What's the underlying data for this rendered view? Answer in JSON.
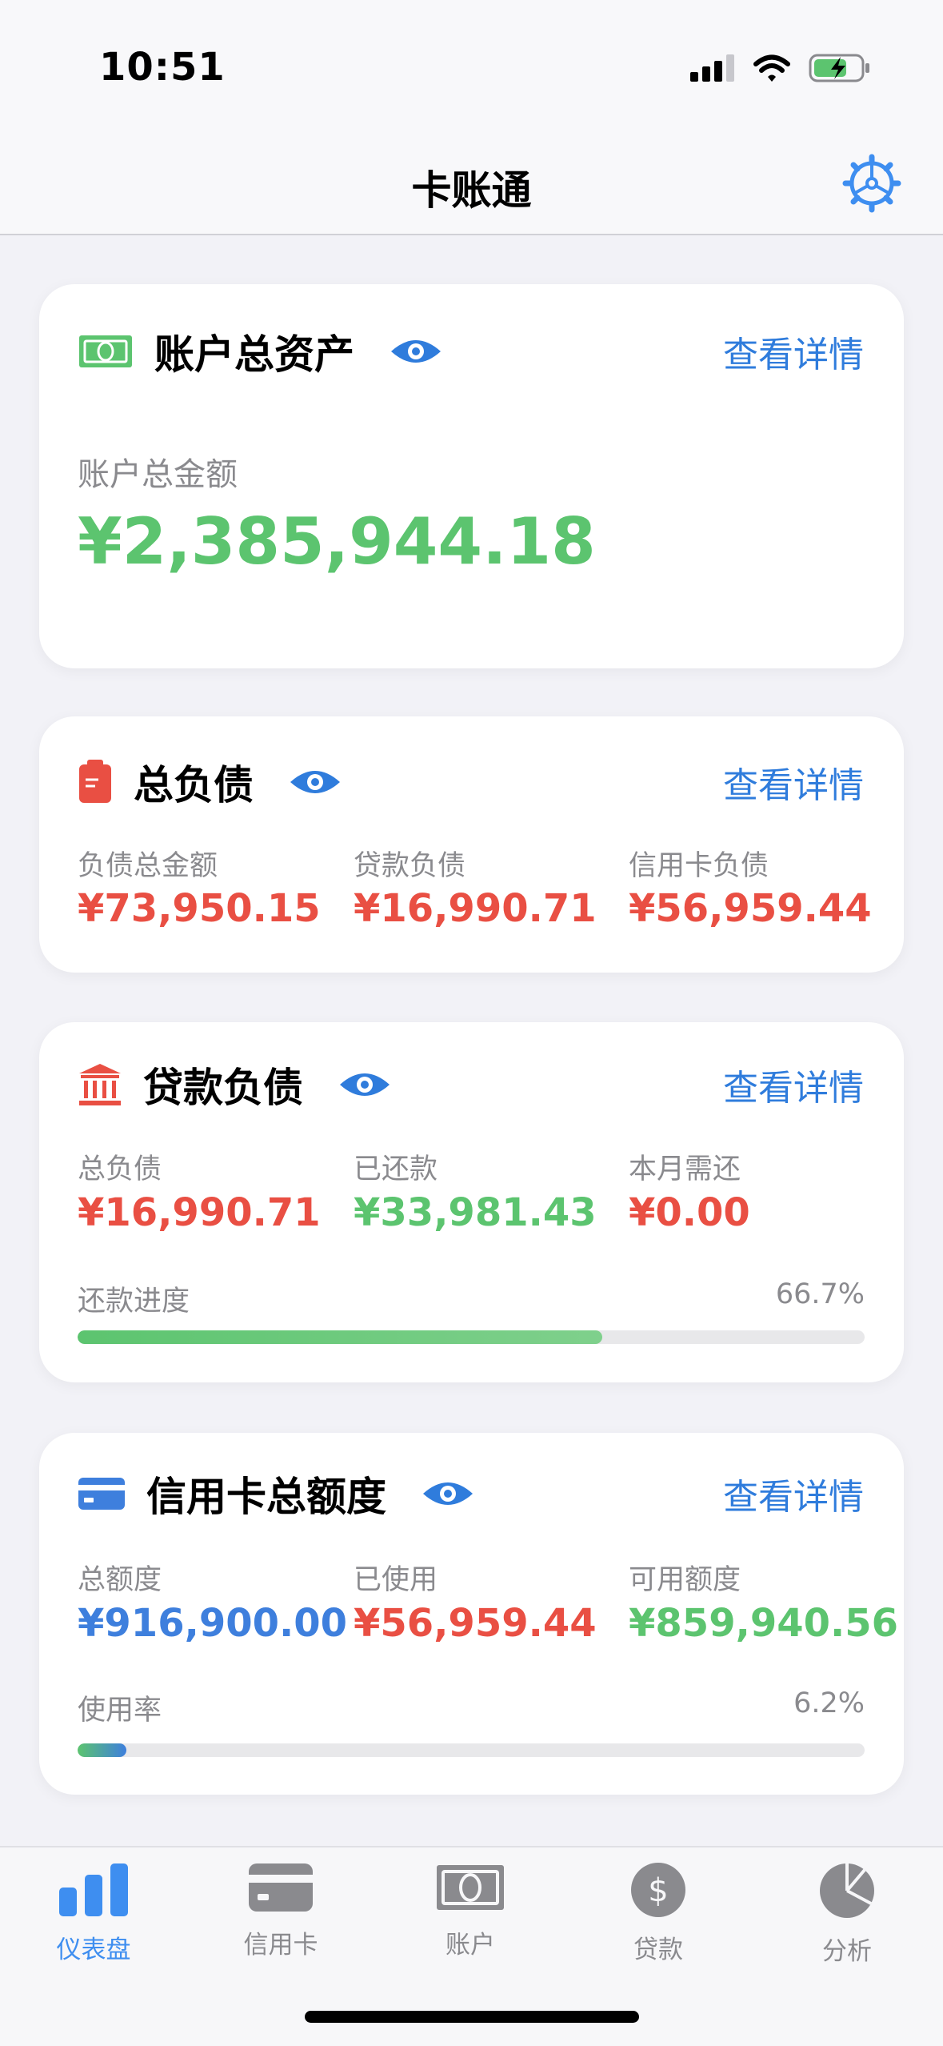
{
  "status": {
    "time": "10:51"
  },
  "nav": {
    "title": "卡账通"
  },
  "colors": {
    "accent": "#2f7cdc",
    "positive": "#5cc46f",
    "negative": "#e94f43",
    "primary_blue": "#3e7fdd"
  },
  "assets": {
    "title": "账户总资产",
    "detail_label": "查看详情",
    "total_label": "账户总金额",
    "total_value": "¥2,385,944.18",
    "icon": "cash-icon"
  },
  "liabilities": {
    "title": "总负债",
    "detail_label": "查看详情",
    "icon": "clipboard-icon",
    "items": [
      {
        "label": "负债总金额",
        "value": "¥73,950.15"
      },
      {
        "label": "贷款负债",
        "value": "¥16,990.71"
      },
      {
        "label": "信用卡负债",
        "value": "¥56,959.44"
      }
    ]
  },
  "loans": {
    "title": "贷款负债",
    "detail_label": "查看详情",
    "icon": "bank-icon",
    "items": [
      {
        "label": "总负债",
        "value": "¥16,990.71"
      },
      {
        "label": "已还款",
        "value": "¥33,981.43"
      },
      {
        "label": "本月需还",
        "value": "¥0.00"
      }
    ],
    "progress_label": "还款进度",
    "progress_pct": "66.7%",
    "progress_value": 66.7
  },
  "credit": {
    "title": "信用卡总额度",
    "detail_label": "查看详情",
    "icon": "credit-card-icon",
    "items": [
      {
        "label": "总额度",
        "value": "¥916,900.00"
      },
      {
        "label": "已使用",
        "value": "¥56,959.44"
      },
      {
        "label": "可用额度",
        "value": "¥859,940.56"
      }
    ],
    "usage_label": "使用率",
    "usage_pct": "6.2%",
    "usage_value": 6.2
  },
  "tabs": [
    {
      "label": "仪表盘",
      "icon": "bar-chart-icon",
      "active": true
    },
    {
      "label": "信用卡",
      "icon": "credit-card-icon",
      "active": false
    },
    {
      "label": "账户",
      "icon": "cash-icon",
      "active": false
    },
    {
      "label": "贷款",
      "icon": "dollar-circle-icon",
      "active": false
    },
    {
      "label": "分析",
      "icon": "pie-chart-icon",
      "active": false
    }
  ]
}
